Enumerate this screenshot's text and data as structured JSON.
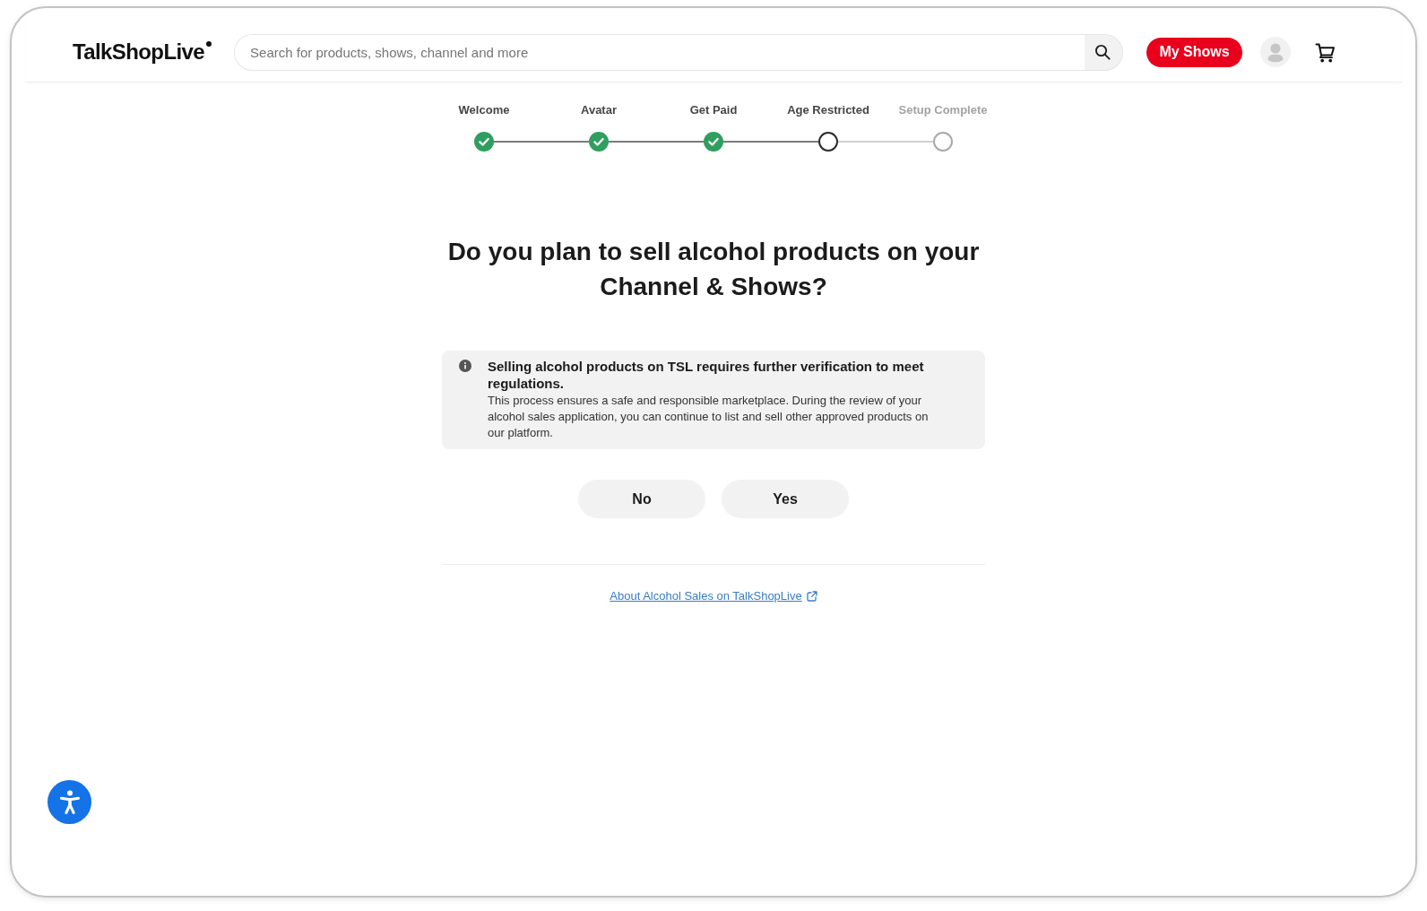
{
  "header": {
    "logo": "TalkShopLive",
    "search": {
      "placeholder": "Search for products, shows, channel and more"
    },
    "my_shows_button": "My Shows"
  },
  "stepper": {
    "steps": [
      {
        "label": "Welcome",
        "completed": true,
        "selected": false
      },
      {
        "label": "Avatar",
        "completed": true,
        "selected": false
      },
      {
        "label": "Get Paid",
        "completed": true,
        "selected": false
      },
      {
        "label": "Age Restricted",
        "completed": false,
        "selected": true
      },
      {
        "label": "Setup Complete",
        "completed": false,
        "selected": false
      }
    ]
  },
  "question": {
    "title": "Do you plan to sell alcohol products on your Channel & Shows?"
  },
  "notice": {
    "title": "Selling alcohol products on TSL requires further verification to meet regulations.",
    "body": "This process ensures a safe and responsible marketplace. During the review of your alcohol sales application, you can continue to list and sell other approved products on our platform."
  },
  "answers": [
    {
      "label": "No"
    },
    {
      "label": "Yes"
    }
  ],
  "help_link": {
    "label": "About Alcohol Sales on TalkShopLive"
  }
}
